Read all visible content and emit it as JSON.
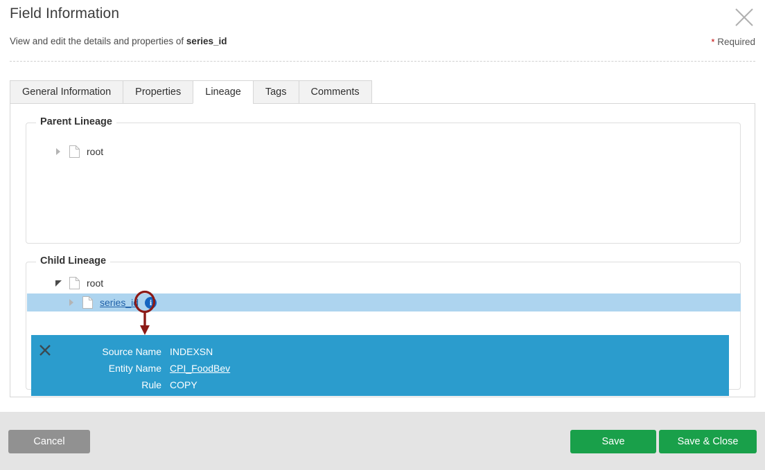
{
  "header": {
    "title": "Field Information",
    "subtitle_prefix": "View and edit the details and properties of ",
    "subtitle_field": "series_id",
    "required_star": "*",
    "required_label": "Required",
    "close_icon": "close-icon"
  },
  "tabs": [
    {
      "label": "General Information",
      "active": false
    },
    {
      "label": "Properties",
      "active": false
    },
    {
      "label": "Lineage",
      "active": true
    },
    {
      "label": "Tags",
      "active": false
    },
    {
      "label": "Comments",
      "active": false
    }
  ],
  "parent_lineage": {
    "legend": "Parent Lineage",
    "nodes": [
      {
        "label": "root",
        "expanded": false,
        "icon": "document-icon"
      }
    ]
  },
  "child_lineage": {
    "legend": "Child Lineage",
    "nodes": [
      {
        "label": "root",
        "expanded": true,
        "icon": "document-icon"
      },
      {
        "label": "series_id",
        "expanded": false,
        "icon": "document-icon",
        "is_link": true,
        "selected": true,
        "badge": "i"
      }
    ]
  },
  "info_popup": {
    "close_icon": "close-icon",
    "rows": [
      {
        "label": "Source Name",
        "value": "INDEXSN",
        "is_link": false
      },
      {
        "label": "Entity Name",
        "value": "CPI_FoodBev",
        "is_link": true
      },
      {
        "label": "Rule",
        "value": "COPY",
        "is_link": false
      }
    ]
  },
  "footer": {
    "cancel_label": "Cancel",
    "save_label": "Save",
    "save_close_label": "Save & Close"
  },
  "colors": {
    "accent_green": "#19a04a",
    "tooltip_blue": "#2b9ccd",
    "row_highlight": "#add4ef",
    "badge_blue": "#1565c0",
    "annotation_red": "#8c1a16",
    "required_red": "#c00000",
    "cancel_gray": "#919191",
    "footer_gray": "#e4e4e4"
  }
}
